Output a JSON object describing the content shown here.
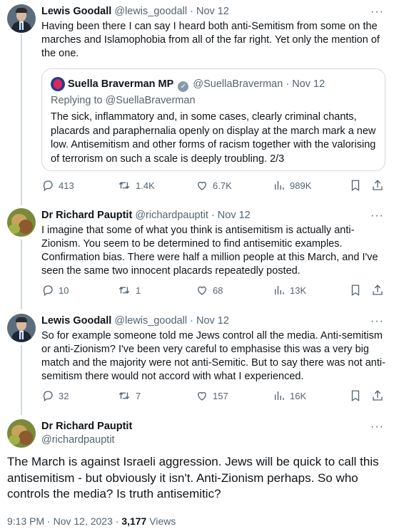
{
  "tweets": [
    {
      "name": "Lewis Goodall",
      "handle": "@lewis_goodall",
      "date": "· Nov 12",
      "text": "Having been there I can say I heard both anti-Semitism from some on the marches and Islamophobia from all of the far right. Yet only the mention of the one.",
      "quote": {
        "name": "Suella Braverman MP",
        "handle": "@SuellaBraverman",
        "date": "· Nov 12",
        "replying": "Replying to @SuellaBraverman",
        "text": "The sick, inflammatory and, in some cases, clearly criminal chants, placards and paraphernalia openly on display at the march mark a new low. Antisemitism and other forms of racism together with the valorising of terrorism on such a scale is deeply troubling. 2/3"
      },
      "replies": "413",
      "retweets": "1.4K",
      "likes": "6.7K",
      "views": "989K"
    },
    {
      "name": "Dr Richard Pauptit",
      "handle": "@richardpauptit",
      "date": "· Nov 12",
      "text": "I imagine that some of what you think is antisemitism is actually anti-Zionism. You seem to be determined to find antisemitic examples. Confirmation bias. There were half a million people at this March, and I've seen the same two innocent placards repeatedly posted.",
      "replies": "10",
      "retweets": "1",
      "likes": "68",
      "views": "13K"
    },
    {
      "name": "Lewis Goodall",
      "handle": "@lewis_goodall",
      "date": "· Nov 12",
      "text": "So for example someone told me Jews control all the media. Anti-semitism or anti-Zionism? I've been very careful to emphasise this was a very big match and the majority were not anti-Semitic. But to say there was not anti-semitism there would not accord with what I experienced.",
      "replies": "32",
      "retweets": "7",
      "likes": "157",
      "views": "16K"
    }
  ],
  "main": {
    "name": "Dr Richard Pauptit",
    "handle": "@richardpauptit",
    "text": "The March is against Israeli aggression. Jews will be quick to call this antisemitism - but obviously it isn't. Anti-Zionism perhaps. So who controls the media? Is truth antisemitic?",
    "time": "9:13 PM · Nov 12, 2023 · ",
    "views_count": "3,177",
    "views_label": " Views"
  },
  "icons": {
    "reply": "reply-icon",
    "retweet": "retweet-icon",
    "like": "like-icon",
    "views": "views-icon",
    "bookmark": "bookmark-icon",
    "share": "share-icon",
    "more": "more-icon",
    "verified": "verified-badge-icon"
  },
  "more_glyph": "···",
  "colors": {
    "text": "#0f1419",
    "muted": "#536471",
    "border": "#cfd9de"
  }
}
